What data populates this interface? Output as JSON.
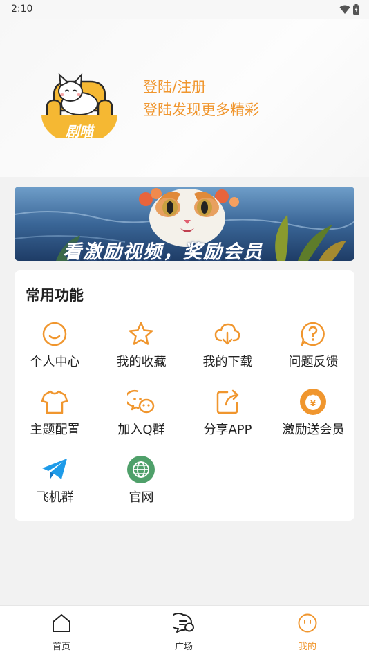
{
  "status_bar": {
    "time": "2:10"
  },
  "header": {
    "logo_text": "剧喵",
    "login_title": "登陆/注册",
    "login_subtitle": "登陆发现更多精彩"
  },
  "banner": {
    "text": "看激励视频，奖励会员"
  },
  "functions": {
    "title": "常用功能",
    "items": [
      {
        "label": "个人中心",
        "icon": "smile-face-icon"
      },
      {
        "label": "我的收藏",
        "icon": "star-icon"
      },
      {
        "label": "我的下载",
        "icon": "cloud-download-icon"
      },
      {
        "label": "问题反馈",
        "icon": "question-bubble-icon"
      },
      {
        "label": "主题配置",
        "icon": "tshirt-icon"
      },
      {
        "label": "加入Q群",
        "icon": "chat-bubbles-icon"
      },
      {
        "label": "分享APP",
        "icon": "share-icon"
      },
      {
        "label": "激励送会员",
        "icon": "reward-icon"
      },
      {
        "label": "飞机群",
        "icon": "telegram-icon"
      },
      {
        "label": "官网",
        "icon": "globe-icon"
      }
    ]
  },
  "tabbar": {
    "tabs": [
      {
        "label": "首页",
        "icon": "home-icon",
        "active": false
      },
      {
        "label": "广场",
        "icon": "chat-icon",
        "active": false
      },
      {
        "label": "我的",
        "icon": "profile-face-icon",
        "active": true
      }
    ]
  },
  "colors": {
    "accent": "#f0962e",
    "background": "#f2f2f2",
    "card": "#ffffff"
  }
}
